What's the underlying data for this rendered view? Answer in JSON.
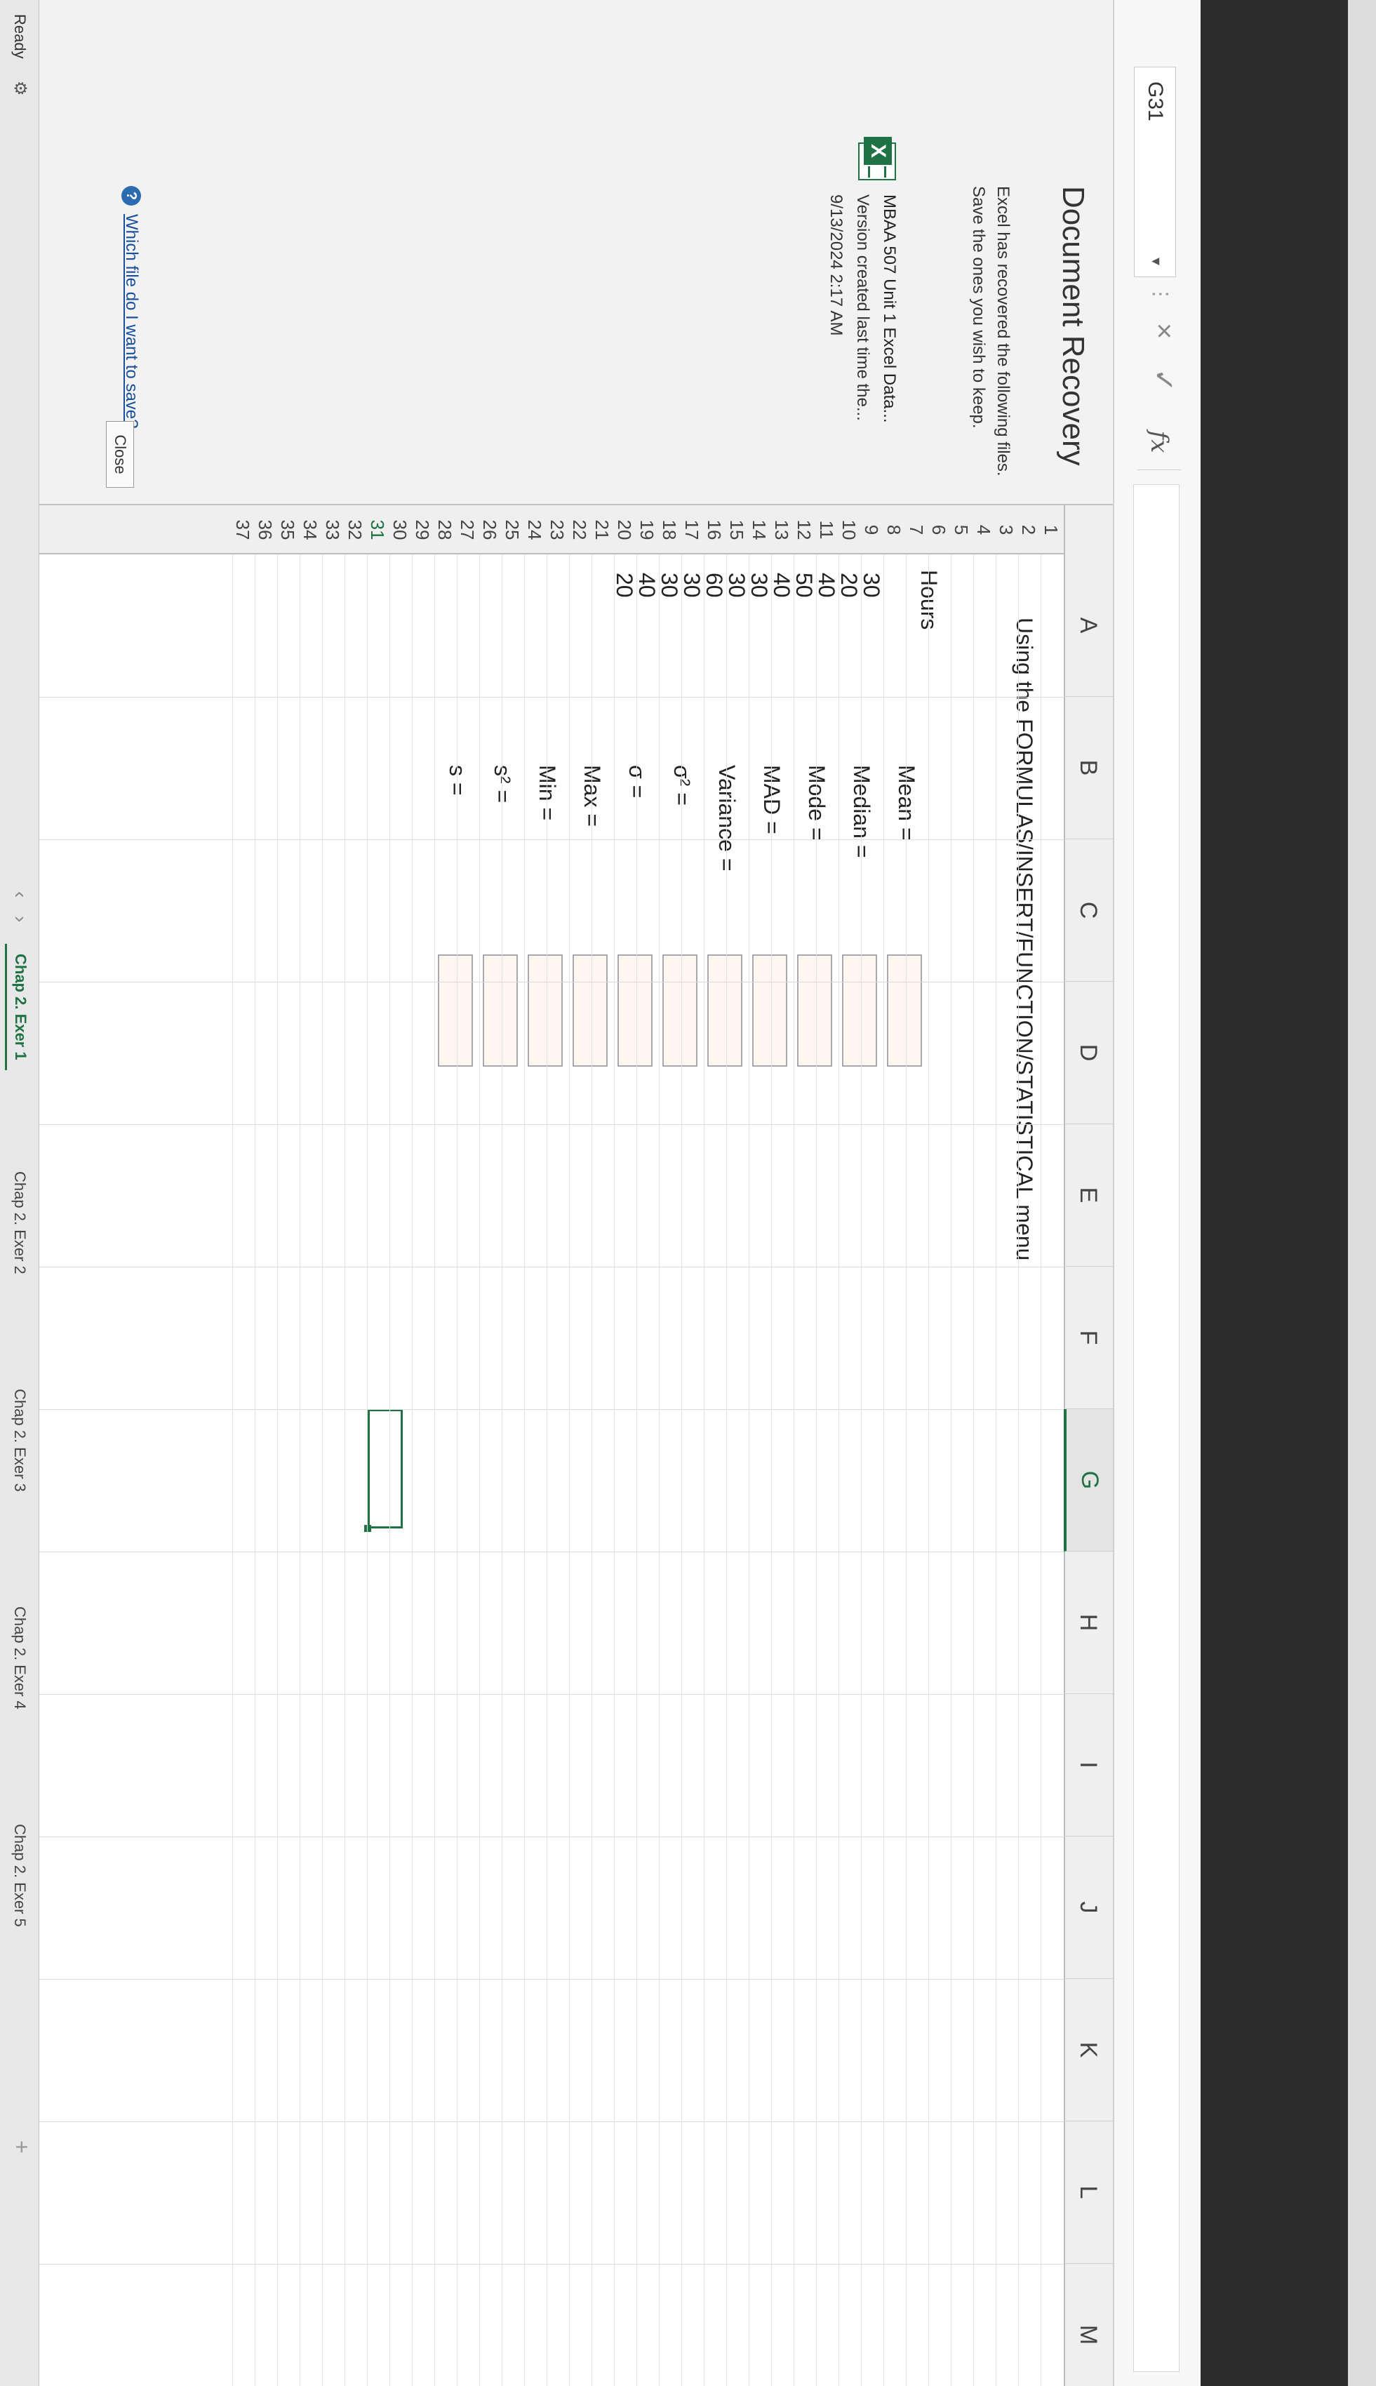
{
  "formula_bar": {
    "name_box": "G31",
    "name_box_arrow": "▾",
    "dots": "⋮",
    "cancel_icon": "×",
    "enter_icon": "✓",
    "fx_label": "fx",
    "value": ""
  },
  "recovery": {
    "title": "Document Recovery",
    "description": "Excel has recovered the following files. Save the ones you wish to keep.",
    "file": {
      "name": "MBAA 507 Unit 1 Excel Data...",
      "version": "Version created last time the...",
      "date": "9/13/2024 2:17 AM"
    },
    "help_icon": "?",
    "help_link": "Which file do I want to save?",
    "close_label": "Close"
  },
  "grid": {
    "columns": [
      "A",
      "B",
      "C",
      "D",
      "E",
      "F",
      "G",
      "H",
      "I",
      "J",
      "K",
      "L",
      "M"
    ],
    "active_column": "G",
    "rows": [
      "1",
      "2",
      "3",
      "4",
      "5",
      "6",
      "7",
      "8",
      "9",
      "10",
      "11",
      "12",
      "13",
      "14",
      "15",
      "16",
      "17",
      "18",
      "19",
      "20",
      "21",
      "22",
      "23",
      "24",
      "25",
      "26",
      "27",
      "28",
      "29",
      "30",
      "31",
      "32",
      "33",
      "34",
      "35",
      "36",
      "37"
    ],
    "active_row": "31",
    "instruction": "Using the FORMULAS/INSERT/FUNCTION/STATISTICAL menu",
    "hours_header": "Hours",
    "hours_values": [
      "30",
      "20",
      "40",
      "50",
      "40",
      "30",
      "30",
      "60",
      "30",
      "30",
      "40",
      "20"
    ],
    "stat_labels": {
      "mean": "Mean =",
      "median": "Median =",
      "mode": "Mode =",
      "mad": "MAD =",
      "variance": "Variance =",
      "sigma2": "σ² =",
      "sigma": "σ =",
      "max": "Max =",
      "min": "Min =",
      "s2": "s² =",
      "s": "s ="
    }
  },
  "tabs": {
    "status": "Ready",
    "status_icon": "⚙",
    "nav_left": "‹",
    "nav_right": "›",
    "sheets": [
      "Chap 2. Exer 1",
      "Chap 2. Exer 2",
      "Chap 2. Exer 3",
      "Chap 2. Exer 4",
      "Chap 2. Exer 5"
    ],
    "active_sheet": "Chap 2. Exer 1",
    "add_icon": "+"
  },
  "colors": {
    "excel_green": "#1f7244",
    "link_blue": "#1a4f9c"
  }
}
